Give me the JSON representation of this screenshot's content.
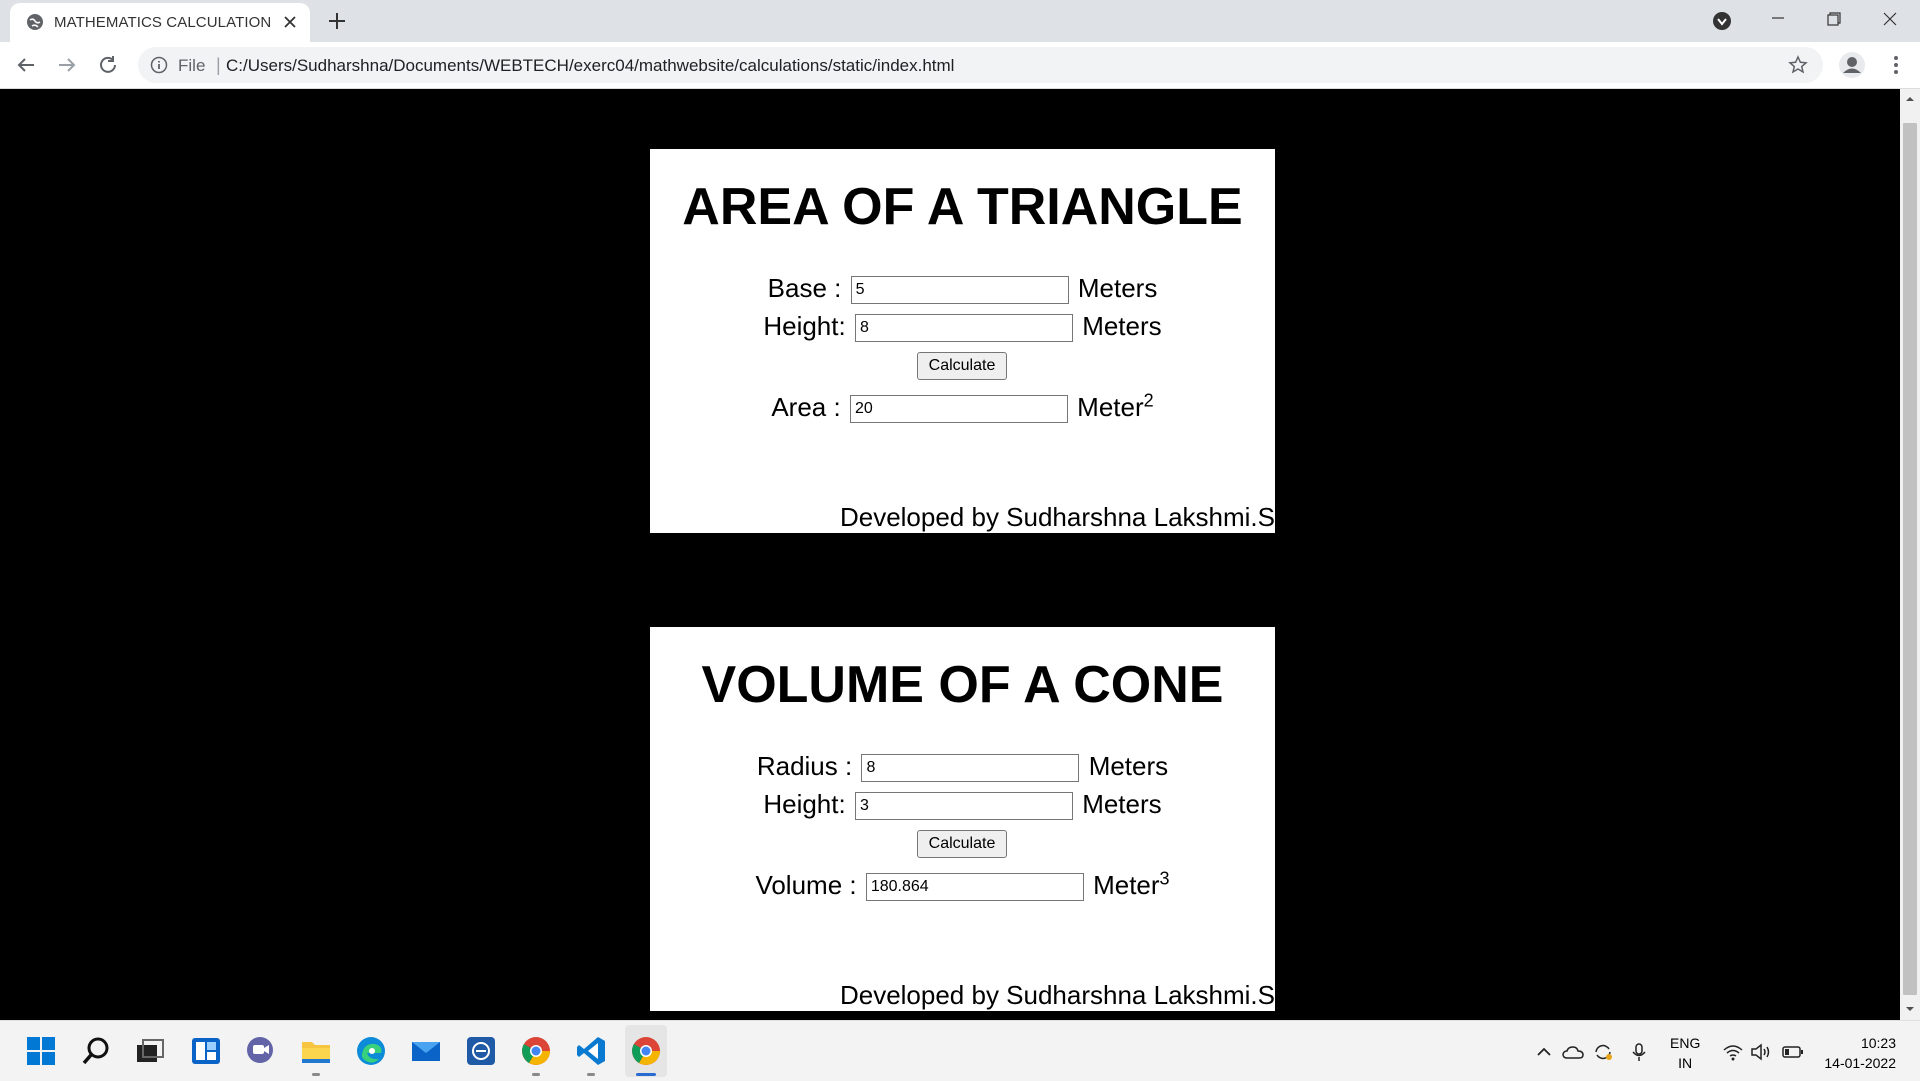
{
  "browser": {
    "tab_title": "MATHEMATICS CALCULATION",
    "omnibox_label": "File",
    "url": "C:/Users/Sudharshna/Documents/WEBTECH/exerc04/mathwebsite/calculations/static/index.html"
  },
  "triangle": {
    "title": "AREA OF A TRIANGLE",
    "base_label": "Base :",
    "base_value": "5",
    "base_unit": "Meters",
    "height_label": "Height:",
    "height_value": "8",
    "height_unit": "Meters",
    "calc_label": "Calculate",
    "area_label": "Area :",
    "area_value": "20",
    "area_unit": "Meter",
    "area_exp": "2",
    "footer": "Developed by Sudharshna Lakshmi.S"
  },
  "cone": {
    "title": "VOLUME OF A CONE",
    "radius_label": "Radius :",
    "radius_value": "8",
    "radius_unit": "Meters",
    "height_label": "Height:",
    "height_value": "3",
    "height_unit": "Meters",
    "calc_label": "Calculate",
    "volume_label": "Volume :",
    "volume_value": "180.864",
    "volume_unit": "Meter",
    "volume_exp": "3",
    "footer": "Developed by Sudharshna Lakshmi.S"
  },
  "taskbar": {
    "lang_top": "ENG",
    "lang_bottom": "IN",
    "time": "10:23",
    "date": "14-01-2022",
    "apps": [
      "start-icon",
      "search-icon",
      "task-view-icon",
      "widgets-icon",
      "chat-icon",
      "file-explorer-icon",
      "edge-icon",
      "mail-icon",
      "dell-icon",
      "chrome-icon",
      "vscode-icon",
      "chrome-active-icon"
    ]
  }
}
